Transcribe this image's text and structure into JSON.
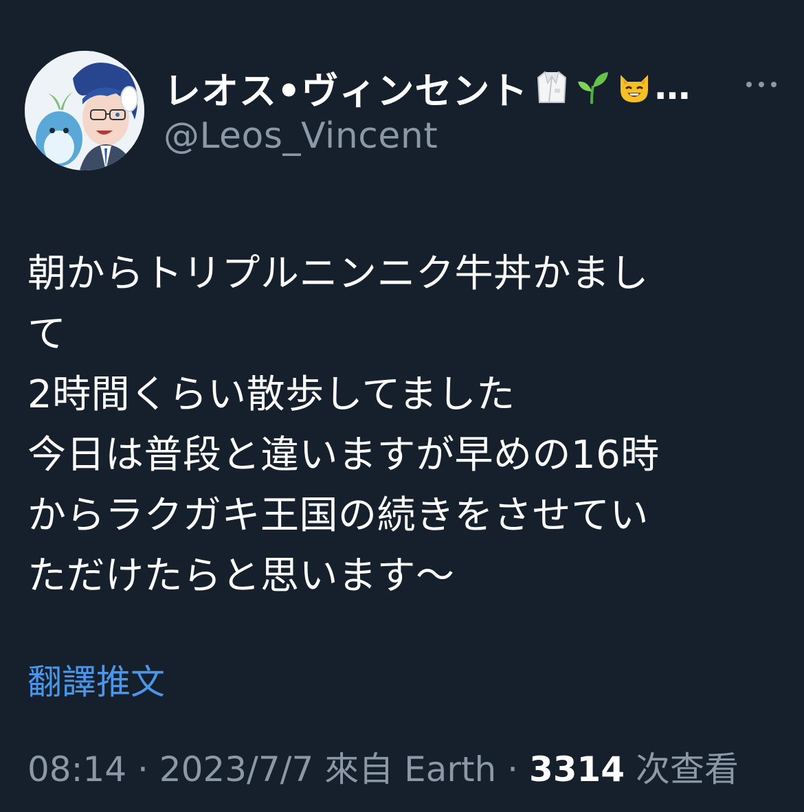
{
  "author": {
    "display_name": "レオス•ヴィンセント",
    "name_emojis": [
      "lab-coat-icon",
      "seedling-icon",
      "smiling-cat-icon"
    ],
    "name_truncation": "…",
    "handle": "@Leos_Vincent",
    "more_icon": "more-horizontal-icon"
  },
  "tweet": {
    "text": "朝からトリプルニンニク牛丼かまし\nて\n2時間くらい散歩してました\n今日は普段と違いますが早めの16時\nからラクガキ王国の続きをさせてい\nただけたらと思います〜",
    "translate_label": "翻譯推文"
  },
  "meta": {
    "time": "08:14",
    "separator": " · ",
    "date": "2023/7/7",
    "source_prefix": "來自",
    "source": "Earth",
    "views": "3314",
    "views_label": "次查看"
  },
  "colors": {
    "background": "#16202c",
    "text_primary": "#ffffff",
    "text_secondary": "#8b98a5",
    "link": "#4a96e8"
  }
}
